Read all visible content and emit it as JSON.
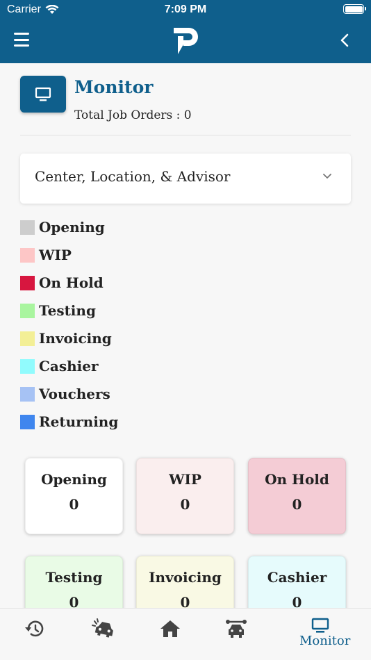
{
  "status_bar": {
    "carrier": "Carrier",
    "time": "7:09 PM"
  },
  "header": {
    "logo": "p-logo",
    "menu_icon": "hamburger-icon",
    "back_icon": "chevron-left-icon"
  },
  "page": {
    "title": "Monitor",
    "total_label": "Total Job Orders : 0"
  },
  "filter": {
    "label": "Center, Location, & Advisor"
  },
  "legend": [
    {
      "label": "Opening",
      "color": "#cdcdcd"
    },
    {
      "label": "WIP",
      "color": "#fdc6c6"
    },
    {
      "label": "On Hold",
      "color": "#d7163f"
    },
    {
      "label": "Testing",
      "color": "#a9f59f"
    },
    {
      "label": "Invoicing",
      "color": "#f3ef96"
    },
    {
      "label": "Cashier",
      "color": "#91fbfd"
    },
    {
      "label": "Vouchers",
      "color": "#a6c2f4"
    },
    {
      "label": "Returning",
      "color": "#3f86ee"
    }
  ],
  "cards": [
    {
      "title": "Opening",
      "count": "0",
      "bg": "#ffffff"
    },
    {
      "title": "WIP",
      "count": "0",
      "bg": "#faeeee"
    },
    {
      "title": "On Hold",
      "count": "0",
      "bg": "#f4ccd5"
    },
    {
      "title": "Testing",
      "count": "0",
      "bg": "#e9fbe6"
    },
    {
      "title": "Invoicing",
      "count": "0",
      "bg": "#f9f9e4"
    },
    {
      "title": "Cashier",
      "count": "0",
      "bg": "#e6fbfc"
    }
  ],
  "bottom_nav": {
    "active_label": "Monitor"
  }
}
